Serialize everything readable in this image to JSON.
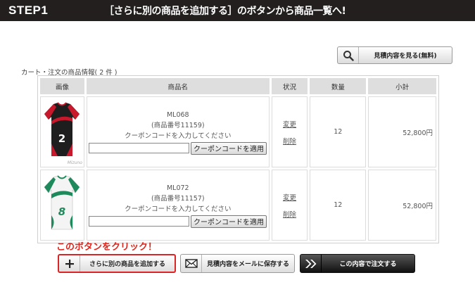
{
  "header": {
    "step": "STEP1",
    "title": "［さらに別の商品を追加する］のボタンから商品一覧へ!"
  },
  "estimate_button": {
    "label": "見積内容を見る(無料)",
    "icon": "search-icon"
  },
  "cart": {
    "caption": "カート・注文の商品情報( 2 件 )",
    "columns": [
      "画像",
      "商品名",
      "状況",
      "数量",
      "小計"
    ],
    "coupon_prompt": "クーポンコードを入力してください",
    "coupon_button": "クーポンコードを適用",
    "change_label": "変更",
    "delete_label": "削除",
    "items": [
      {
        "code": "ML068",
        "number": "(商品番号11159)",
        "qty": "12",
        "subtotal": "52,800円",
        "jersey_number": "2",
        "brand": "Mizuno"
      },
      {
        "code": "ML072",
        "number": "(商品番号11157)",
        "qty": "12",
        "subtotal": "52,800円",
        "jersey_number": "8",
        "brand": ""
      }
    ]
  },
  "note": "このボタンをクリック！",
  "buttons": {
    "add": "さらに別の商品を追加する",
    "mail": "見積内容をメールに保存する",
    "order": "この内容で注文する"
  },
  "colors": {
    "header_bg": "#231f1f",
    "highlight": "#d92525",
    "note": "#e0251c"
  }
}
